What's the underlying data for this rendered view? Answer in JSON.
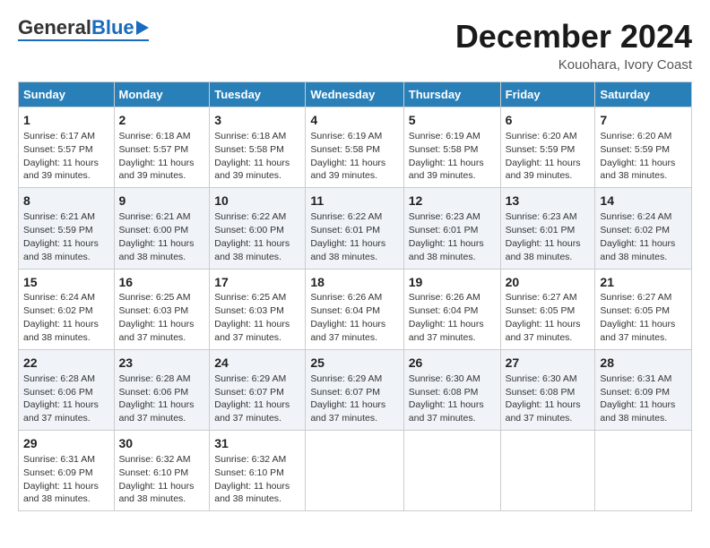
{
  "header": {
    "logo_general": "General",
    "logo_blue": "Blue",
    "month_title": "December 2024",
    "location": "Kouohara, Ivory Coast"
  },
  "calendar": {
    "days_of_week": [
      "Sunday",
      "Monday",
      "Tuesday",
      "Wednesday",
      "Thursday",
      "Friday",
      "Saturday"
    ],
    "weeks": [
      [
        {
          "day": "1",
          "sunrise": "6:17 AM",
          "sunset": "5:57 PM",
          "daylight": "11 hours and 39 minutes."
        },
        {
          "day": "2",
          "sunrise": "6:18 AM",
          "sunset": "5:57 PM",
          "daylight": "11 hours and 39 minutes."
        },
        {
          "day": "3",
          "sunrise": "6:18 AM",
          "sunset": "5:58 PM",
          "daylight": "11 hours and 39 minutes."
        },
        {
          "day": "4",
          "sunrise": "6:19 AM",
          "sunset": "5:58 PM",
          "daylight": "11 hours and 39 minutes."
        },
        {
          "day": "5",
          "sunrise": "6:19 AM",
          "sunset": "5:58 PM",
          "daylight": "11 hours and 39 minutes."
        },
        {
          "day": "6",
          "sunrise": "6:20 AM",
          "sunset": "5:59 PM",
          "daylight": "11 hours and 39 minutes."
        },
        {
          "day": "7",
          "sunrise": "6:20 AM",
          "sunset": "5:59 PM",
          "daylight": "11 hours and 38 minutes."
        }
      ],
      [
        {
          "day": "8",
          "sunrise": "6:21 AM",
          "sunset": "5:59 PM",
          "daylight": "11 hours and 38 minutes."
        },
        {
          "day": "9",
          "sunrise": "6:21 AM",
          "sunset": "6:00 PM",
          "daylight": "11 hours and 38 minutes."
        },
        {
          "day": "10",
          "sunrise": "6:22 AM",
          "sunset": "6:00 PM",
          "daylight": "11 hours and 38 minutes."
        },
        {
          "day": "11",
          "sunrise": "6:22 AM",
          "sunset": "6:01 PM",
          "daylight": "11 hours and 38 minutes."
        },
        {
          "day": "12",
          "sunrise": "6:23 AM",
          "sunset": "6:01 PM",
          "daylight": "11 hours and 38 minutes."
        },
        {
          "day": "13",
          "sunrise": "6:23 AM",
          "sunset": "6:01 PM",
          "daylight": "11 hours and 38 minutes."
        },
        {
          "day": "14",
          "sunrise": "6:24 AM",
          "sunset": "6:02 PM",
          "daylight": "11 hours and 38 minutes."
        }
      ],
      [
        {
          "day": "15",
          "sunrise": "6:24 AM",
          "sunset": "6:02 PM",
          "daylight": "11 hours and 38 minutes."
        },
        {
          "day": "16",
          "sunrise": "6:25 AM",
          "sunset": "6:03 PM",
          "daylight": "11 hours and 37 minutes."
        },
        {
          "day": "17",
          "sunrise": "6:25 AM",
          "sunset": "6:03 PM",
          "daylight": "11 hours and 37 minutes."
        },
        {
          "day": "18",
          "sunrise": "6:26 AM",
          "sunset": "6:04 PM",
          "daylight": "11 hours and 37 minutes."
        },
        {
          "day": "19",
          "sunrise": "6:26 AM",
          "sunset": "6:04 PM",
          "daylight": "11 hours and 37 minutes."
        },
        {
          "day": "20",
          "sunrise": "6:27 AM",
          "sunset": "6:05 PM",
          "daylight": "11 hours and 37 minutes."
        },
        {
          "day": "21",
          "sunrise": "6:27 AM",
          "sunset": "6:05 PM",
          "daylight": "11 hours and 37 minutes."
        }
      ],
      [
        {
          "day": "22",
          "sunrise": "6:28 AM",
          "sunset": "6:06 PM",
          "daylight": "11 hours and 37 minutes."
        },
        {
          "day": "23",
          "sunrise": "6:28 AM",
          "sunset": "6:06 PM",
          "daylight": "11 hours and 37 minutes."
        },
        {
          "day": "24",
          "sunrise": "6:29 AM",
          "sunset": "6:07 PM",
          "daylight": "11 hours and 37 minutes."
        },
        {
          "day": "25",
          "sunrise": "6:29 AM",
          "sunset": "6:07 PM",
          "daylight": "11 hours and 37 minutes."
        },
        {
          "day": "26",
          "sunrise": "6:30 AM",
          "sunset": "6:08 PM",
          "daylight": "11 hours and 37 minutes."
        },
        {
          "day": "27",
          "sunrise": "6:30 AM",
          "sunset": "6:08 PM",
          "daylight": "11 hours and 37 minutes."
        },
        {
          "day": "28",
          "sunrise": "6:31 AM",
          "sunset": "6:09 PM",
          "daylight": "11 hours and 38 minutes."
        }
      ],
      [
        {
          "day": "29",
          "sunrise": "6:31 AM",
          "sunset": "6:09 PM",
          "daylight": "11 hours and 38 minutes."
        },
        {
          "day": "30",
          "sunrise": "6:32 AM",
          "sunset": "6:10 PM",
          "daylight": "11 hours and 38 minutes."
        },
        {
          "day": "31",
          "sunrise": "6:32 AM",
          "sunset": "6:10 PM",
          "daylight": "11 hours and 38 minutes."
        },
        null,
        null,
        null,
        null
      ]
    ]
  }
}
